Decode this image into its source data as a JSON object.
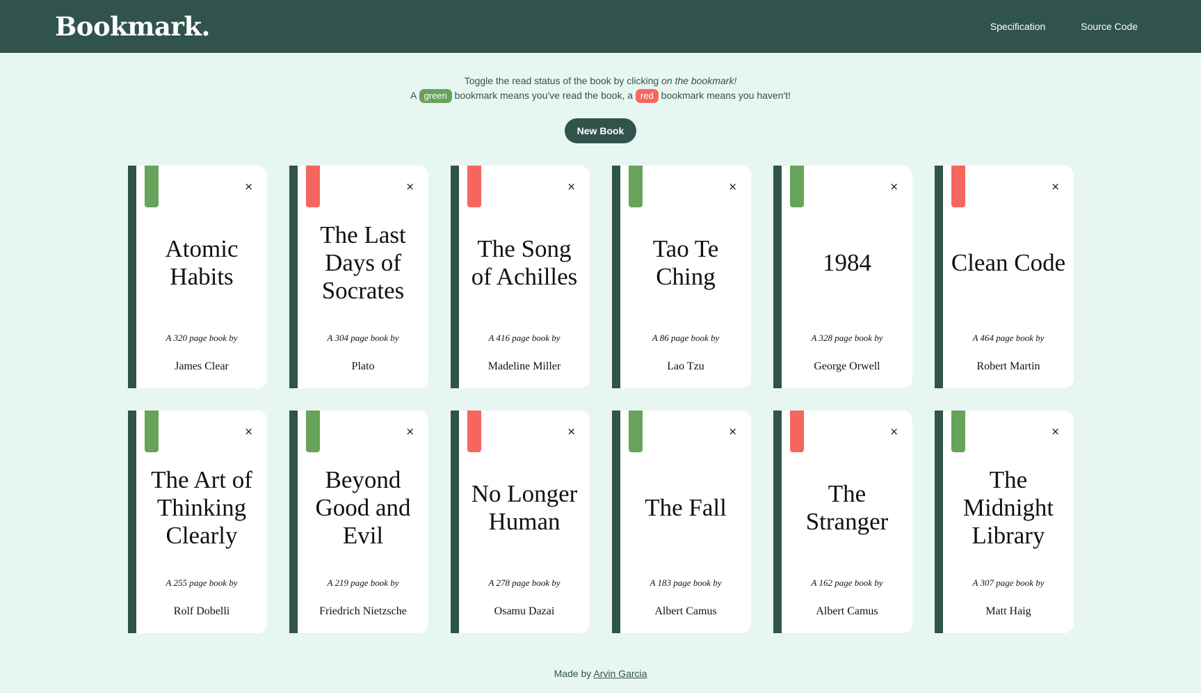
{
  "header": {
    "logo": "Bookmark.",
    "nav": [
      "Specification",
      "Source Code"
    ]
  },
  "intro": {
    "line1_prefix": "Toggle the read status of the book by clicking ",
    "line1_em": "on the bookmark!",
    "line2_a": "A ",
    "green_label": "green",
    "line2_b": " bookmark means you've read the book, a ",
    "red_label": "red",
    "line2_c": " bookmark means you haven't!"
  },
  "new_book_label": "New Book",
  "close_glyph": "×",
  "books": [
    {
      "title": "Atomic Habits",
      "pages_text": "A 320 page book by",
      "author": "James Clear",
      "read": true
    },
    {
      "title": "The Last Days of Socrates",
      "pages_text": "A 304 page book by",
      "author": "Plato",
      "read": false
    },
    {
      "title": "The Song of Achilles",
      "pages_text": "A 416 page book by",
      "author": "Madeline Miller",
      "read": false
    },
    {
      "title": "Tao Te Ching",
      "pages_text": "A 86 page book by",
      "author": "Lao Tzu",
      "read": true
    },
    {
      "title": "1984",
      "pages_text": "A 328 page book by",
      "author": "George Orwell",
      "read": true
    },
    {
      "title": "Clean Code",
      "pages_text": "A 464 page book by",
      "author": "Robert Martin",
      "read": false
    },
    {
      "title": "The Art of Thinking Clearly",
      "pages_text": "A 255 page book by",
      "author": "Rolf Dobelli",
      "read": true
    },
    {
      "title": "Beyond Good and Evil",
      "pages_text": "A 219 page book by",
      "author": "Friedrich Nietzsche",
      "read": true
    },
    {
      "title": "No Longer Human",
      "pages_text": "A 278 page book by",
      "author": "Osamu Dazai",
      "read": false
    },
    {
      "title": "The Fall",
      "pages_text": "A 183 page book by",
      "author": "Albert Camus",
      "read": true
    },
    {
      "title": "The Stranger",
      "pages_text": "A 162 page book by",
      "author": "Albert Camus",
      "read": false
    },
    {
      "title": "The Midnight Library",
      "pages_text": "A 307 page book by",
      "author": "Matt Haig",
      "read": true
    }
  ],
  "footer": {
    "prefix": "Made by ",
    "link": "Arvin Garcia"
  },
  "colors": {
    "primary": "#30534c",
    "background": "#e8f6f1",
    "read": "#67a35a",
    "unread": "#f5665f"
  }
}
